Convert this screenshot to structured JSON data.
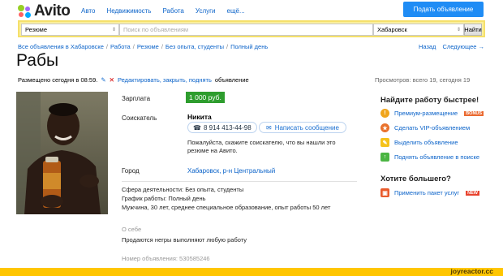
{
  "header": {
    "logo_text": "Avito",
    "nav": [
      "Авто",
      "Недвижимость",
      "Работа",
      "Услуги",
      "ещё..."
    ],
    "post_ad_label": "Подать объявление"
  },
  "search": {
    "category": "Резюме",
    "placeholder": "Поиск по объявлениям",
    "region": "Хабаровск",
    "find_label": "Найти"
  },
  "breadcrumb": [
    "Все объявления в Хабаровске",
    "Работа",
    "Резюме",
    "Без опыта, студенты",
    "Полный день"
  ],
  "pager": {
    "back": "Назад",
    "next": "Следующее →"
  },
  "ad": {
    "title": "Рабы",
    "posted": "Размещено сегодня в 08:59.",
    "edit_link": "Редактировать, закрыть, поднять",
    "edit_suffix": "объявление",
    "views": "Просмотров: всего 19, сегодня 19",
    "salary_label": "Зарплата",
    "salary": "1 000 руб.",
    "seller_label": "Соискатель",
    "seller_name": "Никита",
    "phone": "8 914 413-44-98",
    "write_label": "Написать сообщение",
    "note": "Пожалуйста, скажите соискателю, что вы нашли это резюме на Авито.",
    "city_label": "Город",
    "city": "Хабаровск, р-н Центральный",
    "params": [
      "Сфера деятельности: Без опыта, студенты",
      "График работы: Полный день",
      "Мужчина, 30 лет, среднее специальное образование, опыт работы 50 лет"
    ],
    "about_title": "О себе",
    "about_text": "Продаются негры выполняют любую работу",
    "ad_number": "Номер объявления: 530585246"
  },
  "sidebar": {
    "title": "Найдите работу быстрее!",
    "items": [
      {
        "label": "Премиум-размещение",
        "badge": "BONUS",
        "icon": "premium-icon",
        "color": "#f0a51c"
      },
      {
        "label": "Сделать VIP-объявлением",
        "badge": "",
        "icon": "vip-icon",
        "color": "#e9712b"
      },
      {
        "label": "Выделить объявление",
        "badge": "",
        "icon": "highlight-icon",
        "color": "#f5c21a"
      },
      {
        "label": "Поднять объявление в поиске",
        "badge": "",
        "icon": "up-arrow-icon",
        "color": "#4bb543"
      }
    ],
    "more_title": "Хотите большего?",
    "package": {
      "label": "Применить пакет услуг",
      "badge": "NEW",
      "icon": "gift-icon",
      "color": "#e95b2c"
    }
  },
  "watermark": "joyreactor.cc",
  "colors": {
    "accent": "#1f8cf5",
    "link": "#0b63c9",
    "salary": "#2e9d2e",
    "search_bg": "#fbef9c",
    "footer": "#ffc600"
  }
}
